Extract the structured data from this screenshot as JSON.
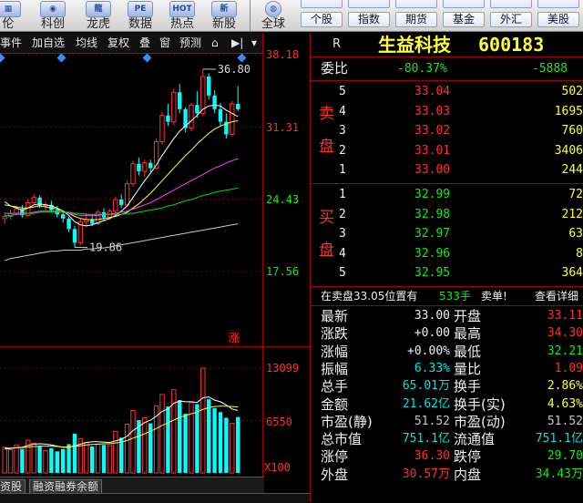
{
  "toolbar": {
    "buttons": [
      {
        "label": "伦",
        "icon": "app"
      },
      {
        "label": "科创",
        "icon": "app"
      },
      {
        "label": "龙虎",
        "icon": "app"
      },
      {
        "label": "数据",
        "icon": "PE"
      },
      {
        "label": "热点",
        "icon": "HOT"
      },
      {
        "label": "新股",
        "icon": "app"
      },
      {
        "label": "全球",
        "icon": "globe"
      }
    ],
    "tabs_row2": [
      "个股",
      "指数",
      "期货",
      "基金",
      "外汇",
      "美股"
    ]
  },
  "chart_toolbar": {
    "items": [
      "事件",
      "加自选",
      "均线",
      "复权",
      "叠",
      "窗",
      "预测",
      "⌂",
      "▶|",
      "▾"
    ]
  },
  "chart_data": {
    "type": "candlestick",
    "price_axis_ticks": [
      "38.18",
      "31.31",
      "24.43",
      "17.56"
    ],
    "high_label": "36.80",
    "low_label": "19.86",
    "zhang_label": "涨",
    "volume_axis_ticks": [
      "13099",
      "6550",
      "X100"
    ],
    "candles": [
      [
        22.6,
        23.2,
        22.1,
        22.8
      ],
      [
        22.8,
        23.4,
        22.5,
        23.1
      ],
      [
        23.1,
        23.8,
        22.9,
        23.5
      ],
      [
        23.5,
        23.9,
        22.7,
        22.9
      ],
      [
        22.9,
        24.4,
        22.8,
        24.1
      ],
      [
        24.1,
        24.9,
        23.9,
        24.6
      ],
      [
        24.6,
        24.8,
        23.6,
        23.8
      ],
      [
        23.8,
        24.2,
        23.3,
        23.9
      ],
      [
        23.9,
        24.3,
        23.2,
        23.4
      ],
      [
        23.4,
        23.8,
        22.7,
        23.0
      ],
      [
        23.0,
        23.2,
        22.2,
        22.6
      ],
      [
        22.6,
        22.8,
        21.3,
        21.6
      ],
      [
        21.6,
        21.9,
        19.86,
        20.3
      ],
      [
        20.3,
        22.6,
        20.1,
        22.3
      ],
      [
        22.3,
        23.1,
        21.8,
        22.5
      ],
      [
        22.5,
        22.9,
        21.9,
        22.1
      ],
      [
        22.1,
        23.4,
        22.0,
        23.2
      ],
      [
        23.2,
        23.6,
        22.4,
        22.7
      ],
      [
        22.7,
        23.5,
        22.5,
        23.3
      ],
      [
        23.3,
        24.7,
        23.1,
        24.4
      ],
      [
        24.4,
        24.9,
        23.6,
        23.9
      ],
      [
        23.9,
        26.2,
        23.8,
        25.9
      ],
      [
        25.9,
        28.1,
        25.6,
        27.8
      ],
      [
        27.8,
        28.4,
        26.7,
        27.1
      ],
      [
        27.1,
        28.2,
        26.6,
        27.9
      ],
      [
        27.9,
        28.2,
        27.0,
        27.4
      ],
      [
        27.4,
        30.2,
        27.3,
        29.9
      ],
      [
        29.9,
        32.7,
        29.6,
        32.4
      ],
      [
        32.4,
        33.5,
        31.4,
        31.8
      ],
      [
        31.8,
        34.9,
        31.5,
        34.6
      ],
      [
        34.6,
        35.4,
        32.6,
        33.0
      ],
      [
        33.0,
        33.2,
        30.8,
        31.2
      ],
      [
        31.2,
        33.6,
        30.9,
        33.4
      ],
      [
        33.4,
        34.7,
        32.2,
        32.6
      ],
      [
        32.6,
        36.8,
        32.4,
        36.1
      ],
      [
        36.1,
        36.4,
        33.9,
        34.3
      ],
      [
        34.3,
        34.8,
        32.6,
        33.0
      ],
      [
        33.0,
        33.6,
        31.4,
        31.8
      ],
      [
        31.8,
        32.6,
        30.2,
        30.6
      ],
      [
        30.6,
        33.8,
        30.4,
        33.5
      ],
      [
        33.5,
        35.2,
        32.8,
        33.0
      ]
    ],
    "ma_series": [
      {
        "color": "#ffffff",
        "values": [
          24.2,
          23.8,
          23.6,
          23.4,
          23.6,
          23.9,
          24.0,
          23.9,
          23.8,
          23.6,
          23.3,
          22.9,
          22.3,
          22.0,
          21.9,
          22.0,
          22.2,
          22.4,
          22.6,
          22.9,
          23.3,
          23.8,
          24.6,
          25.4,
          26.2,
          26.9,
          27.7,
          28.6,
          29.4,
          30.2,
          30.9,
          31.4,
          31.9,
          32.4,
          33.0,
          33.3,
          33.4,
          33.3,
          32.9,
          32.6,
          32.3
        ]
      },
      {
        "color": "#ffff30",
        "values": [
          23.9,
          23.8,
          23.7,
          23.6,
          23.6,
          23.7,
          23.8,
          23.7,
          23.6,
          23.5,
          23.3,
          23.1,
          22.8,
          22.6,
          22.5,
          22.5,
          22.5,
          22.6,
          22.7,
          22.8,
          23.0,
          23.2,
          23.6,
          24.0,
          24.5,
          25.0,
          25.6,
          26.2,
          26.8,
          27.4,
          28.0,
          28.6,
          29.1,
          29.7,
          30.2,
          30.7,
          31.1,
          31.4,
          31.6,
          31.8,
          31.9
        ]
      },
      {
        "color": "#ff40ff",
        "values": [
          23.1,
          23.1,
          23.1,
          23.1,
          23.1,
          23.2,
          23.3,
          23.3,
          23.3,
          23.3,
          23.2,
          23.1,
          23.0,
          22.9,
          22.9,
          22.9,
          22.9,
          23.0,
          23.0,
          23.1,
          23.2,
          23.3,
          23.5,
          23.7,
          23.9,
          24.1,
          24.4,
          24.7,
          25.0,
          25.3,
          25.6,
          25.9,
          26.2,
          26.5,
          26.8,
          27.1,
          27.4,
          27.6,
          27.9,
          28.1,
          28.3
        ]
      },
      {
        "color": "#00e000",
        "values": [
          22.9,
          22.9,
          23.0,
          23.0,
          23.1,
          23.1,
          23.2,
          23.2,
          23.2,
          23.2,
          23.2,
          23.2,
          23.1,
          23.1,
          23.0,
          23.0,
          23.0,
          23.0,
          23.0,
          23.0,
          23.0,
          23.1,
          23.1,
          23.2,
          23.3,
          23.4,
          23.5,
          23.6,
          23.8,
          23.9,
          24.1,
          24.3,
          24.4,
          24.6,
          24.8,
          24.9,
          25.1,
          25.2,
          25.3,
          25.4,
          25.5
        ]
      },
      {
        "color": "#c8c8c8",
        "values": [
          18.6,
          18.8,
          18.9,
          19.0,
          19.1,
          19.2,
          19.3,
          19.4,
          19.5,
          19.5,
          19.6,
          19.6,
          19.6,
          19.6,
          19.7,
          19.7,
          19.8,
          19.8,
          19.9,
          20.0,
          20.1,
          20.2,
          20.3,
          20.4,
          20.5,
          20.6,
          20.7,
          20.8,
          20.9,
          21.0,
          21.1,
          21.2,
          21.3,
          21.4,
          21.5,
          21.6,
          21.7,
          21.8,
          21.9,
          22.0,
          22.1
        ]
      }
    ],
    "volumes": [
      3200,
      2900,
      3500,
      3000,
      4100,
      3700,
      3300,
      2800,
      3100,
      2700,
      3000,
      3600,
      4900,
      4300,
      3800,
      3300,
      3600,
      3500,
      3400,
      5200,
      4400,
      6100,
      7800,
      6600,
      6900,
      6200,
      8400,
      9800,
      8300,
      10400,
      9100,
      7400,
      8800,
      8600,
      13099,
      9200,
      8100,
      7600,
      6900,
      6200,
      7000
    ],
    "vol_ma": [
      {
        "color": "#ffffff",
        "values": [
          3000,
          3050,
          3150,
          3200,
          3450,
          3600,
          3650,
          3600,
          3500,
          3350,
          3200,
          3200,
          3400,
          3600,
          3800,
          3900,
          3900,
          3850,
          3800,
          4000,
          4200,
          4600,
          5300,
          5800,
          6300,
          6600,
          7100,
          7700,
          8000,
          8700,
          9000,
          8900,
          8900,
          8800,
          9400,
          9500,
          9100,
          8900,
          8500,
          8000,
          7800
        ]
      },
      {
        "color": "#ffff30",
        "values": [
          3100,
          3100,
          3150,
          3150,
          3250,
          3300,
          3350,
          3350,
          3350,
          3300,
          3250,
          3250,
          3300,
          3400,
          3500,
          3550,
          3600,
          3650,
          3650,
          3750,
          3850,
          4050,
          4350,
          4600,
          4900,
          5200,
          5550,
          5950,
          6250,
          6600,
          6950,
          7150,
          7400,
          7600,
          7950,
          8150,
          8300,
          8350,
          8350,
          8300,
          8250
        ]
      }
    ]
  },
  "bottom_tabs": [
    "资股",
    "融资融券余额"
  ],
  "stock": {
    "prefix": "R",
    "name": "生益科技",
    "code": "600183"
  },
  "weibi": {
    "label": "委比",
    "value": "-80.37%",
    "diff": "-5888"
  },
  "sell": {
    "label_chars": [
      "卖",
      "盘"
    ],
    "rows": [
      {
        "level": "5",
        "price": "33.04",
        "vol": "502"
      },
      {
        "level": "4",
        "price": "33.03",
        "vol": "1695"
      },
      {
        "level": "3",
        "price": "33.02",
        "vol": "760"
      },
      {
        "level": "2",
        "price": "33.01",
        "vol": "3406"
      },
      {
        "level": "1",
        "price": "33.00",
        "vol": "244"
      }
    ]
  },
  "buy": {
    "label_chars": [
      "买",
      "盘"
    ],
    "rows": [
      {
        "level": "1",
        "price": "32.99",
        "vol": "72"
      },
      {
        "level": "2",
        "price": "32.98",
        "vol": "212"
      },
      {
        "level": "3",
        "price": "32.97",
        "vol": "63"
      },
      {
        "level": "4",
        "price": "32.96",
        "vol": "8"
      },
      {
        "level": "5",
        "price": "32.95",
        "vol": "364"
      }
    ]
  },
  "alert": {
    "text": "在卖盘33.05位置有",
    "vol": "533手",
    "action": "卖单!",
    "detail": "查看详细"
  },
  "stats": [
    {
      "l1": "最新",
      "v1": "33.00",
      "c1": "white",
      "l2": "开盘",
      "v2": "33.11",
      "c2": "red"
    },
    {
      "l1": "涨跌",
      "v1": "+0.00",
      "c1": "white",
      "l2": "最高",
      "v2": "34.30",
      "c2": "red"
    },
    {
      "l1": "涨幅",
      "v1": "+0.00%",
      "c1": "white",
      "l2": "最低",
      "v2": "32.21",
      "c2": "green"
    },
    {
      "l1": "振幅",
      "v1": "6.33%",
      "c1": "cyan",
      "l2": "量比",
      "v2": "1.09",
      "c2": "red"
    },
    {
      "l1": "总手",
      "v1": "65.01万",
      "c1": "cyan",
      "l2": "换手",
      "v2": "2.86%",
      "c2": "yellow"
    },
    {
      "l1": "金额",
      "v1": "21.62亿",
      "c1": "cyan",
      "l2": "换手(实)",
      "v2": "4.63%",
      "c2": "yellow"
    },
    {
      "l1": "市盈(静)",
      "v1": "51.52",
      "c1": "gray",
      "l2": "市盈(动)",
      "v2": "51.52",
      "c2": "gray"
    },
    {
      "l1": "总市值",
      "v1": "751.1亿",
      "c1": "cyan",
      "l2": "流通值",
      "v2": "751.1亿",
      "c2": "cyan"
    },
    {
      "l1": "涨停",
      "v1": "36.30",
      "c1": "red",
      "l2": "跌停",
      "v2": "29.70",
      "c2": "green"
    },
    {
      "l1": "外盘",
      "v1": "30.57万",
      "c1": "red",
      "l2": "内盘",
      "v2": "34.43万",
      "c2": "green"
    }
  ],
  "colors": {
    "up": "#ff3030",
    "down": "#00ffff",
    "grid": "#a00000"
  }
}
